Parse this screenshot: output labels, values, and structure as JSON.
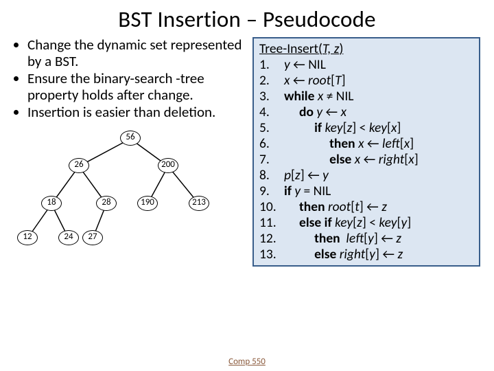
{
  "title": "BST Insertion – Pseudocode",
  "bullets": [
    "Change the dynamic set represented by a BST.",
    "Ensure the binary-search -tree property holds after change.",
    "Insertion is easier than deletion."
  ],
  "tree": {
    "nodes": [
      "56",
      "26",
      "200",
      "18",
      "28",
      "190",
      "213",
      "12",
      "24",
      "27"
    ]
  },
  "pseudo": {
    "header_fn": "Tree-Insert(",
    "header_args": "T, z",
    "header_close": ")",
    "lines": [
      {
        "n": "1.",
        "pad": "",
        "seg": [
          {
            "t": "it",
            "v": "y"
          },
          {
            "t": "p",
            "v": " ← NIL"
          }
        ]
      },
      {
        "n": "2.",
        "pad": "",
        "seg": [
          {
            "t": "it",
            "v": "x"
          },
          {
            "t": "p",
            "v": " ← "
          },
          {
            "t": "it",
            "v": "root"
          },
          {
            "t": "p",
            "v": "["
          },
          {
            "t": "it",
            "v": "T"
          },
          {
            "t": "p",
            "v": "]"
          }
        ]
      },
      {
        "n": "3.",
        "pad": "",
        "seg": [
          {
            "t": "bold",
            "v": "while "
          },
          {
            "t": "it",
            "v": "x"
          },
          {
            "t": "p",
            "v": " ≠ NIL"
          }
        ]
      },
      {
        "n": "4.",
        "pad": "     ",
        "seg": [
          {
            "t": "bold",
            "v": "do "
          },
          {
            "t": "it",
            "v": "y"
          },
          {
            "t": "p",
            "v": " ← "
          },
          {
            "t": "it",
            "v": "x"
          }
        ]
      },
      {
        "n": "5.",
        "pad": "          ",
        "seg": [
          {
            "t": "bold",
            "v": "if "
          },
          {
            "t": "it",
            "v": "key"
          },
          {
            "t": "p",
            "v": "["
          },
          {
            "t": "it",
            "v": "z"
          },
          {
            "t": "p",
            "v": "] < "
          },
          {
            "t": "it",
            "v": "key"
          },
          {
            "t": "p",
            "v": "["
          },
          {
            "t": "it",
            "v": "x"
          },
          {
            "t": "p",
            "v": "]"
          }
        ]
      },
      {
        "n": "6.",
        "pad": "               ",
        "seg": [
          {
            "t": "bold",
            "v": "then "
          },
          {
            "t": "it",
            "v": "x"
          },
          {
            "t": "p",
            "v": " ← "
          },
          {
            "t": "it",
            "v": "left"
          },
          {
            "t": "p",
            "v": "["
          },
          {
            "t": "it",
            "v": "x"
          },
          {
            "t": "p",
            "v": "]"
          }
        ]
      },
      {
        "n": "7.",
        "pad": "               ",
        "seg": [
          {
            "t": "bold",
            "v": "else "
          },
          {
            "t": "it",
            "v": "x"
          },
          {
            "t": "p",
            "v": " ← "
          },
          {
            "t": "it",
            "v": "right"
          },
          {
            "t": "p",
            "v": "["
          },
          {
            "t": "it",
            "v": "x"
          },
          {
            "t": "p",
            "v": "]"
          }
        ]
      },
      {
        "n": "8.",
        "pad": "",
        "seg": [
          {
            "t": "it",
            "v": "p"
          },
          {
            "t": "p",
            "v": "["
          },
          {
            "t": "it",
            "v": "z"
          },
          {
            "t": "p",
            "v": "] ← "
          },
          {
            "t": "it",
            "v": "y"
          }
        ]
      },
      {
        "n": "9.",
        "pad": "",
        "seg": [
          {
            "t": "bold",
            "v": "if "
          },
          {
            "t": "it",
            "v": "y"
          },
          {
            "t": "p",
            "v": " = NIL"
          }
        ]
      },
      {
        "n": "10.",
        "pad": "     ",
        "seg": [
          {
            "t": "bold",
            "v": "then "
          },
          {
            "t": "it",
            "v": "root"
          },
          {
            "t": "p",
            "v": "["
          },
          {
            "t": "it",
            "v": "t"
          },
          {
            "t": "p",
            "v": "] ← "
          },
          {
            "t": "it",
            "v": "z"
          }
        ]
      },
      {
        "n": "11.",
        "pad": "     ",
        "seg": [
          {
            "t": "bold",
            "v": "else if "
          },
          {
            "t": "it",
            "v": "key"
          },
          {
            "t": "p",
            "v": "["
          },
          {
            "t": "it",
            "v": "z"
          },
          {
            "t": "p",
            "v": "] < "
          },
          {
            "t": "it",
            "v": "key"
          },
          {
            "t": "p",
            "v": "["
          },
          {
            "t": "it",
            "v": "y"
          },
          {
            "t": "p",
            "v": "]"
          }
        ]
      },
      {
        "n": "12.",
        "pad": "          ",
        "seg": [
          {
            "t": "bold",
            "v": "then  "
          },
          {
            "t": "it",
            "v": "left"
          },
          {
            "t": "p",
            "v": "["
          },
          {
            "t": "it",
            "v": "y"
          },
          {
            "t": "p",
            "v": "] ← "
          },
          {
            "t": "it",
            "v": "z"
          }
        ]
      },
      {
        "n": "13.",
        "pad": "          ",
        "seg": [
          {
            "t": "bold",
            "v": "else "
          },
          {
            "t": "it",
            "v": "right"
          },
          {
            "t": "p",
            "v": "["
          },
          {
            "t": "it",
            "v": "y"
          },
          {
            "t": "p",
            "v": "] ← "
          },
          {
            "t": "it",
            "v": "z"
          }
        ]
      }
    ]
  },
  "footer": "Comp 550"
}
